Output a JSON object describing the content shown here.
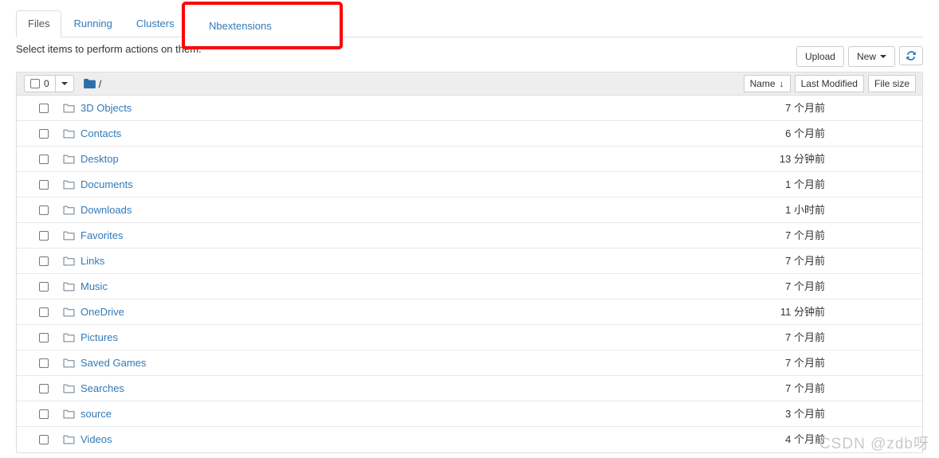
{
  "tabs": [
    {
      "label": "Files",
      "active": true
    },
    {
      "label": "Running",
      "active": false
    },
    {
      "label": "Clusters",
      "active": false
    }
  ],
  "highlighted_tab": {
    "label": "Nbextensions"
  },
  "subtitle": "Select items to perform actions on them.",
  "toolbar": {
    "upload_label": "Upload",
    "new_label": "New",
    "refresh_icon": "refresh-icon"
  },
  "list_header": {
    "select_count": "0",
    "select_checkbox_icon": "checkbox-icon",
    "dropdown_icon": "caret-down-icon",
    "breadcrumb_folder_icon": "folder-filled-icon",
    "breadcrumb_path": "/",
    "sort_name_label": "Name",
    "sort_name_arrow": "↓",
    "sort_modified_label": "Last Modified",
    "sort_size_label": "File size"
  },
  "rows": [
    {
      "name": "3D Objects",
      "modified": "7 个月前",
      "size": ""
    },
    {
      "name": "Contacts",
      "modified": "6 个月前",
      "size": ""
    },
    {
      "name": "Desktop",
      "modified": "13 分钟前",
      "size": ""
    },
    {
      "name": "Documents",
      "modified": "1 个月前",
      "size": ""
    },
    {
      "name": "Downloads",
      "modified": "1 小时前",
      "size": ""
    },
    {
      "name": "Favorites",
      "modified": "7 个月前",
      "size": ""
    },
    {
      "name": "Links",
      "modified": "7 个月前",
      "size": ""
    },
    {
      "name": "Music",
      "modified": "7 个月前",
      "size": ""
    },
    {
      "name": "OneDrive",
      "modified": "11 分钟前",
      "size": ""
    },
    {
      "name": "Pictures",
      "modified": "7 个月前",
      "size": ""
    },
    {
      "name": "Saved Games",
      "modified": "7 个月前",
      "size": ""
    },
    {
      "name": "Searches",
      "modified": "7 个月前",
      "size": ""
    },
    {
      "name": "source",
      "modified": "3 个月前",
      "size": ""
    },
    {
      "name": "Videos",
      "modified": "4 个月前",
      "size": ""
    }
  ],
  "watermark": "CSDN @zdb呀",
  "colors": {
    "link": "#337ab7",
    "annotation": "#fd0000",
    "header_bg": "#eeeeee",
    "border": "#dddddd"
  }
}
